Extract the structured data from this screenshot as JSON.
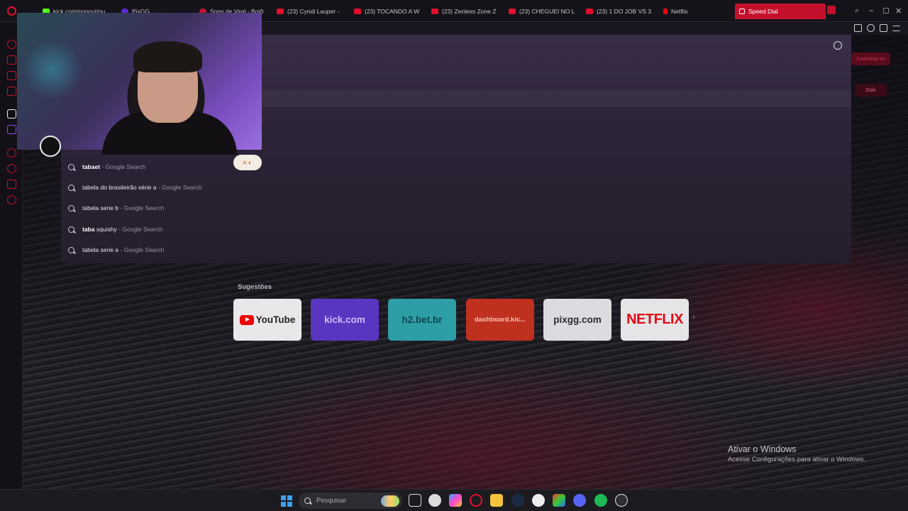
{
  "tabs": [
    {
      "label": "kick.com/popout/gu",
      "favicon": "kick-icon"
    },
    {
      "label": "PixGG",
      "favicon": "pixgg-icon"
    },
    {
      "label": "Sons de Viral - Botõ",
      "favicon": "sons-icon"
    },
    {
      "label": "(23) Cyndi Lauper - ",
      "favicon": "youtube-icon"
    },
    {
      "label": "(23) TOCANDO A W",
      "favicon": "youtube-icon"
    },
    {
      "label": "(23) Zenless Zone Z",
      "favicon": "youtube-icon"
    },
    {
      "label": "(23) CHEGUEI NO LI",
      "favicon": "youtube-icon"
    },
    {
      "label": "(23) 1 DO JOB VS 3",
      "favicon": "youtube-icon"
    },
    {
      "label": "Netflix",
      "favicon": "netflix-icon"
    },
    {
      "label": "Speed Dial",
      "favicon": "grid-icon",
      "active": true
    }
  ],
  "suggestions": [
    {
      "bold": "tabaet",
      "rest": "",
      "source": "Google Search"
    },
    {
      "bold": "",
      "rest": "tabela do brasileirão série a",
      "source": "Google Search"
    },
    {
      "bold": "",
      "rest": "tabela serie b",
      "source": "Google Search"
    },
    {
      "bold": "taba",
      "rest": " squishy",
      "source": "Google Search"
    },
    {
      "bold": "",
      "rest": "tabela serie a",
      "source": "Google Search"
    }
  ],
  "speed_dial": {
    "heading": "Sugestões",
    "tiles": [
      {
        "label": "YouTube",
        "kind": "yt"
      },
      {
        "label": "kick.com",
        "kind": "kick"
      },
      {
        "label": "h2.bet.br",
        "kind": "h2"
      },
      {
        "label": "dashboard.kic...",
        "kind": "dash"
      },
      {
        "label": "pixgg.com",
        "kind": "pix"
      },
      {
        "label": "NETFLIX",
        "kind": "nf"
      }
    ]
  },
  "background_page": {
    "button1": "Cadastrar-se",
    "button2": "Oslo"
  },
  "activation": {
    "title": "Ativar o Windows",
    "subtitle": "Acesse Configurações para ativar o Windows."
  },
  "taskbar": {
    "search_placeholder": "Pesquisar"
  },
  "colors": {
    "accent": "#c5102d",
    "dropdown_top": "#3a2e48",
    "dropdown_bottom": "#241e2c"
  }
}
